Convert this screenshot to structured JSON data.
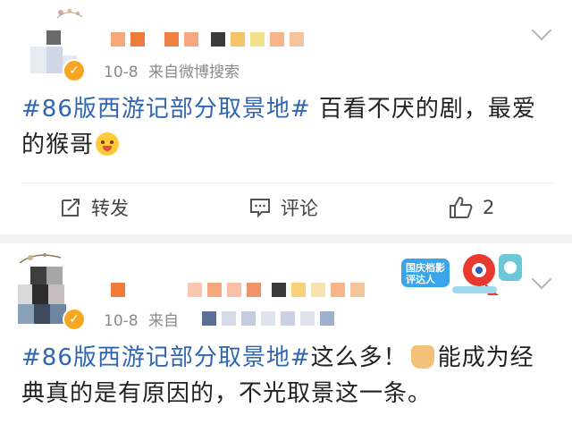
{
  "post1": {
    "date": "10-8",
    "source": "来自微博搜索",
    "hashtag": "#86版西游记部分取景地#",
    "text": " 百看不厌的剧，最爱的猴哥",
    "actions": {
      "repost_label": "转发",
      "comment_label": "评论",
      "like_count": "2"
    }
  },
  "post2": {
    "date": "10-8",
    "source_partial": "来自",
    "badge_text": "国庆档影评达人",
    "hashtag": "#86版西游记部分取景地#",
    "text_part1": "这么多！",
    "text_part2": "能成为经典真的是有原因的，不光取景这一条。"
  },
  "icons": {
    "repost": "repost-icon",
    "comment": "comment-icon",
    "like": "thumb-up-icon",
    "expand": "chevron-down-icon",
    "verified": "verified-badge-icon"
  },
  "colors": {
    "hashtag": "#2f66b3",
    "meta": "#8a8a8a",
    "verified": "#f5a623",
    "separator": "#f2f2f2"
  }
}
